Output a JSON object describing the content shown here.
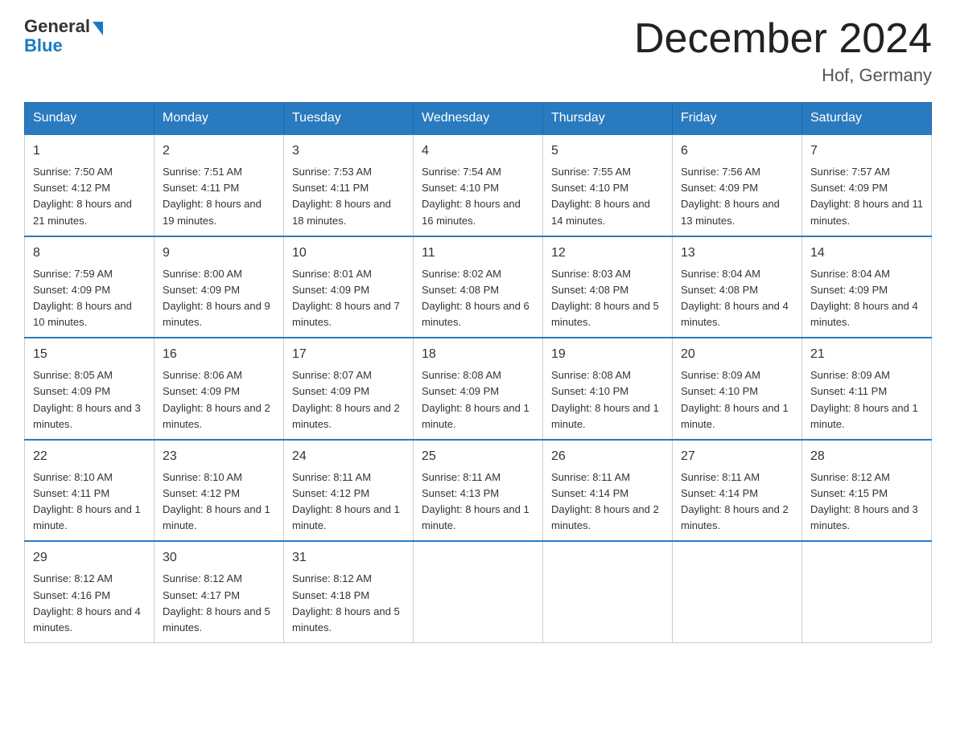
{
  "header": {
    "logo_general": "General",
    "logo_blue": "Blue",
    "month_title": "December 2024",
    "location": "Hof, Germany"
  },
  "days_of_week": [
    "Sunday",
    "Monday",
    "Tuesday",
    "Wednesday",
    "Thursday",
    "Friday",
    "Saturday"
  ],
  "weeks": [
    [
      {
        "day": "1",
        "sunrise": "7:50 AM",
        "sunset": "4:12 PM",
        "daylight": "8 hours and 21 minutes."
      },
      {
        "day": "2",
        "sunrise": "7:51 AM",
        "sunset": "4:11 PM",
        "daylight": "8 hours and 19 minutes."
      },
      {
        "day": "3",
        "sunrise": "7:53 AM",
        "sunset": "4:11 PM",
        "daylight": "8 hours and 18 minutes."
      },
      {
        "day": "4",
        "sunrise": "7:54 AM",
        "sunset": "4:10 PM",
        "daylight": "8 hours and 16 minutes."
      },
      {
        "day": "5",
        "sunrise": "7:55 AM",
        "sunset": "4:10 PM",
        "daylight": "8 hours and 14 minutes."
      },
      {
        "day": "6",
        "sunrise": "7:56 AM",
        "sunset": "4:09 PM",
        "daylight": "8 hours and 13 minutes."
      },
      {
        "day": "7",
        "sunrise": "7:57 AM",
        "sunset": "4:09 PM",
        "daylight": "8 hours and 11 minutes."
      }
    ],
    [
      {
        "day": "8",
        "sunrise": "7:59 AM",
        "sunset": "4:09 PM",
        "daylight": "8 hours and 10 minutes."
      },
      {
        "day": "9",
        "sunrise": "8:00 AM",
        "sunset": "4:09 PM",
        "daylight": "8 hours and 9 minutes."
      },
      {
        "day": "10",
        "sunrise": "8:01 AM",
        "sunset": "4:09 PM",
        "daylight": "8 hours and 7 minutes."
      },
      {
        "day": "11",
        "sunrise": "8:02 AM",
        "sunset": "4:08 PM",
        "daylight": "8 hours and 6 minutes."
      },
      {
        "day": "12",
        "sunrise": "8:03 AM",
        "sunset": "4:08 PM",
        "daylight": "8 hours and 5 minutes."
      },
      {
        "day": "13",
        "sunrise": "8:04 AM",
        "sunset": "4:08 PM",
        "daylight": "8 hours and 4 minutes."
      },
      {
        "day": "14",
        "sunrise": "8:04 AM",
        "sunset": "4:09 PM",
        "daylight": "8 hours and 4 minutes."
      }
    ],
    [
      {
        "day": "15",
        "sunrise": "8:05 AM",
        "sunset": "4:09 PM",
        "daylight": "8 hours and 3 minutes."
      },
      {
        "day": "16",
        "sunrise": "8:06 AM",
        "sunset": "4:09 PM",
        "daylight": "8 hours and 2 minutes."
      },
      {
        "day": "17",
        "sunrise": "8:07 AM",
        "sunset": "4:09 PM",
        "daylight": "8 hours and 2 minutes."
      },
      {
        "day": "18",
        "sunrise": "8:08 AM",
        "sunset": "4:09 PM",
        "daylight": "8 hours and 1 minute."
      },
      {
        "day": "19",
        "sunrise": "8:08 AM",
        "sunset": "4:10 PM",
        "daylight": "8 hours and 1 minute."
      },
      {
        "day": "20",
        "sunrise": "8:09 AM",
        "sunset": "4:10 PM",
        "daylight": "8 hours and 1 minute."
      },
      {
        "day": "21",
        "sunrise": "8:09 AM",
        "sunset": "4:11 PM",
        "daylight": "8 hours and 1 minute."
      }
    ],
    [
      {
        "day": "22",
        "sunrise": "8:10 AM",
        "sunset": "4:11 PM",
        "daylight": "8 hours and 1 minute."
      },
      {
        "day": "23",
        "sunrise": "8:10 AM",
        "sunset": "4:12 PM",
        "daylight": "8 hours and 1 minute."
      },
      {
        "day": "24",
        "sunrise": "8:11 AM",
        "sunset": "4:12 PM",
        "daylight": "8 hours and 1 minute."
      },
      {
        "day": "25",
        "sunrise": "8:11 AM",
        "sunset": "4:13 PM",
        "daylight": "8 hours and 1 minute."
      },
      {
        "day": "26",
        "sunrise": "8:11 AM",
        "sunset": "4:14 PM",
        "daylight": "8 hours and 2 minutes."
      },
      {
        "day": "27",
        "sunrise": "8:11 AM",
        "sunset": "4:14 PM",
        "daylight": "8 hours and 2 minutes."
      },
      {
        "day": "28",
        "sunrise": "8:12 AM",
        "sunset": "4:15 PM",
        "daylight": "8 hours and 3 minutes."
      }
    ],
    [
      {
        "day": "29",
        "sunrise": "8:12 AM",
        "sunset": "4:16 PM",
        "daylight": "8 hours and 4 minutes."
      },
      {
        "day": "30",
        "sunrise": "8:12 AM",
        "sunset": "4:17 PM",
        "daylight": "8 hours and 5 minutes."
      },
      {
        "day": "31",
        "sunrise": "8:12 AM",
        "sunset": "4:18 PM",
        "daylight": "8 hours and 5 minutes."
      },
      null,
      null,
      null,
      null
    ]
  ]
}
